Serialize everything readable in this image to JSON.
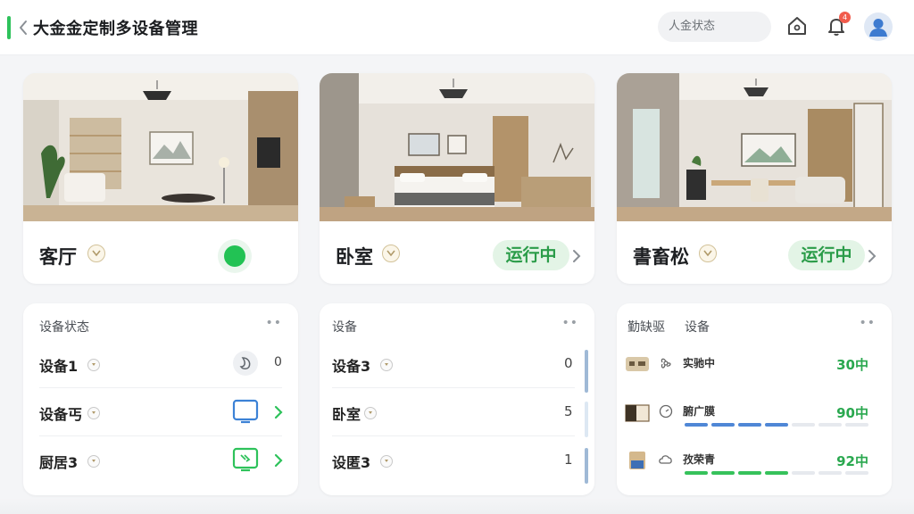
{
  "header": {
    "title": "大金金定制多设备管理",
    "search_placeholder": "人金状态",
    "notification_count": "4",
    "accent_color": "#2ec25b"
  },
  "rooms": [
    {
      "name": "客厅",
      "status": "",
      "status_indicator": "green-dot"
    },
    {
      "name": "卧室",
      "status": "运行中"
    },
    {
      "name": "書畜松",
      "status": "运行中"
    }
  ],
  "panels": {
    "left": {
      "title": "设备状态",
      "rows": [
        {
          "label": "设备1",
          "value": "0",
          "icon": "moon-icon"
        },
        {
          "label": "设备丐",
          "icon": "screen-icon"
        },
        {
          "label": "厨居3",
          "icon": "display-refresh-icon"
        }
      ]
    },
    "middle": {
      "title": "设备",
      "rows": [
        {
          "label": "设备3",
          "value": "0"
        },
        {
          "label": "卧室",
          "value": "5"
        },
        {
          "label": "设匿3",
          "value": "1"
        }
      ]
    },
    "right": {
      "title_prefix": "勤缺驱",
      "title": "设备",
      "rows": [
        {
          "label": "实驰中",
          "value": "30中",
          "progress": null
        },
        {
          "label": "腑广膜",
          "value": "90中",
          "progress": 0.55
        },
        {
          "label": "孜荣青",
          "value": "92中",
          "progress": 0.55
        }
      ]
    }
  },
  "colors": {
    "running_bg": "#e3f4e6",
    "running_text": "#2b9c49",
    "progress_blue": "#4f87d6",
    "progress_green": "#36c25b"
  }
}
